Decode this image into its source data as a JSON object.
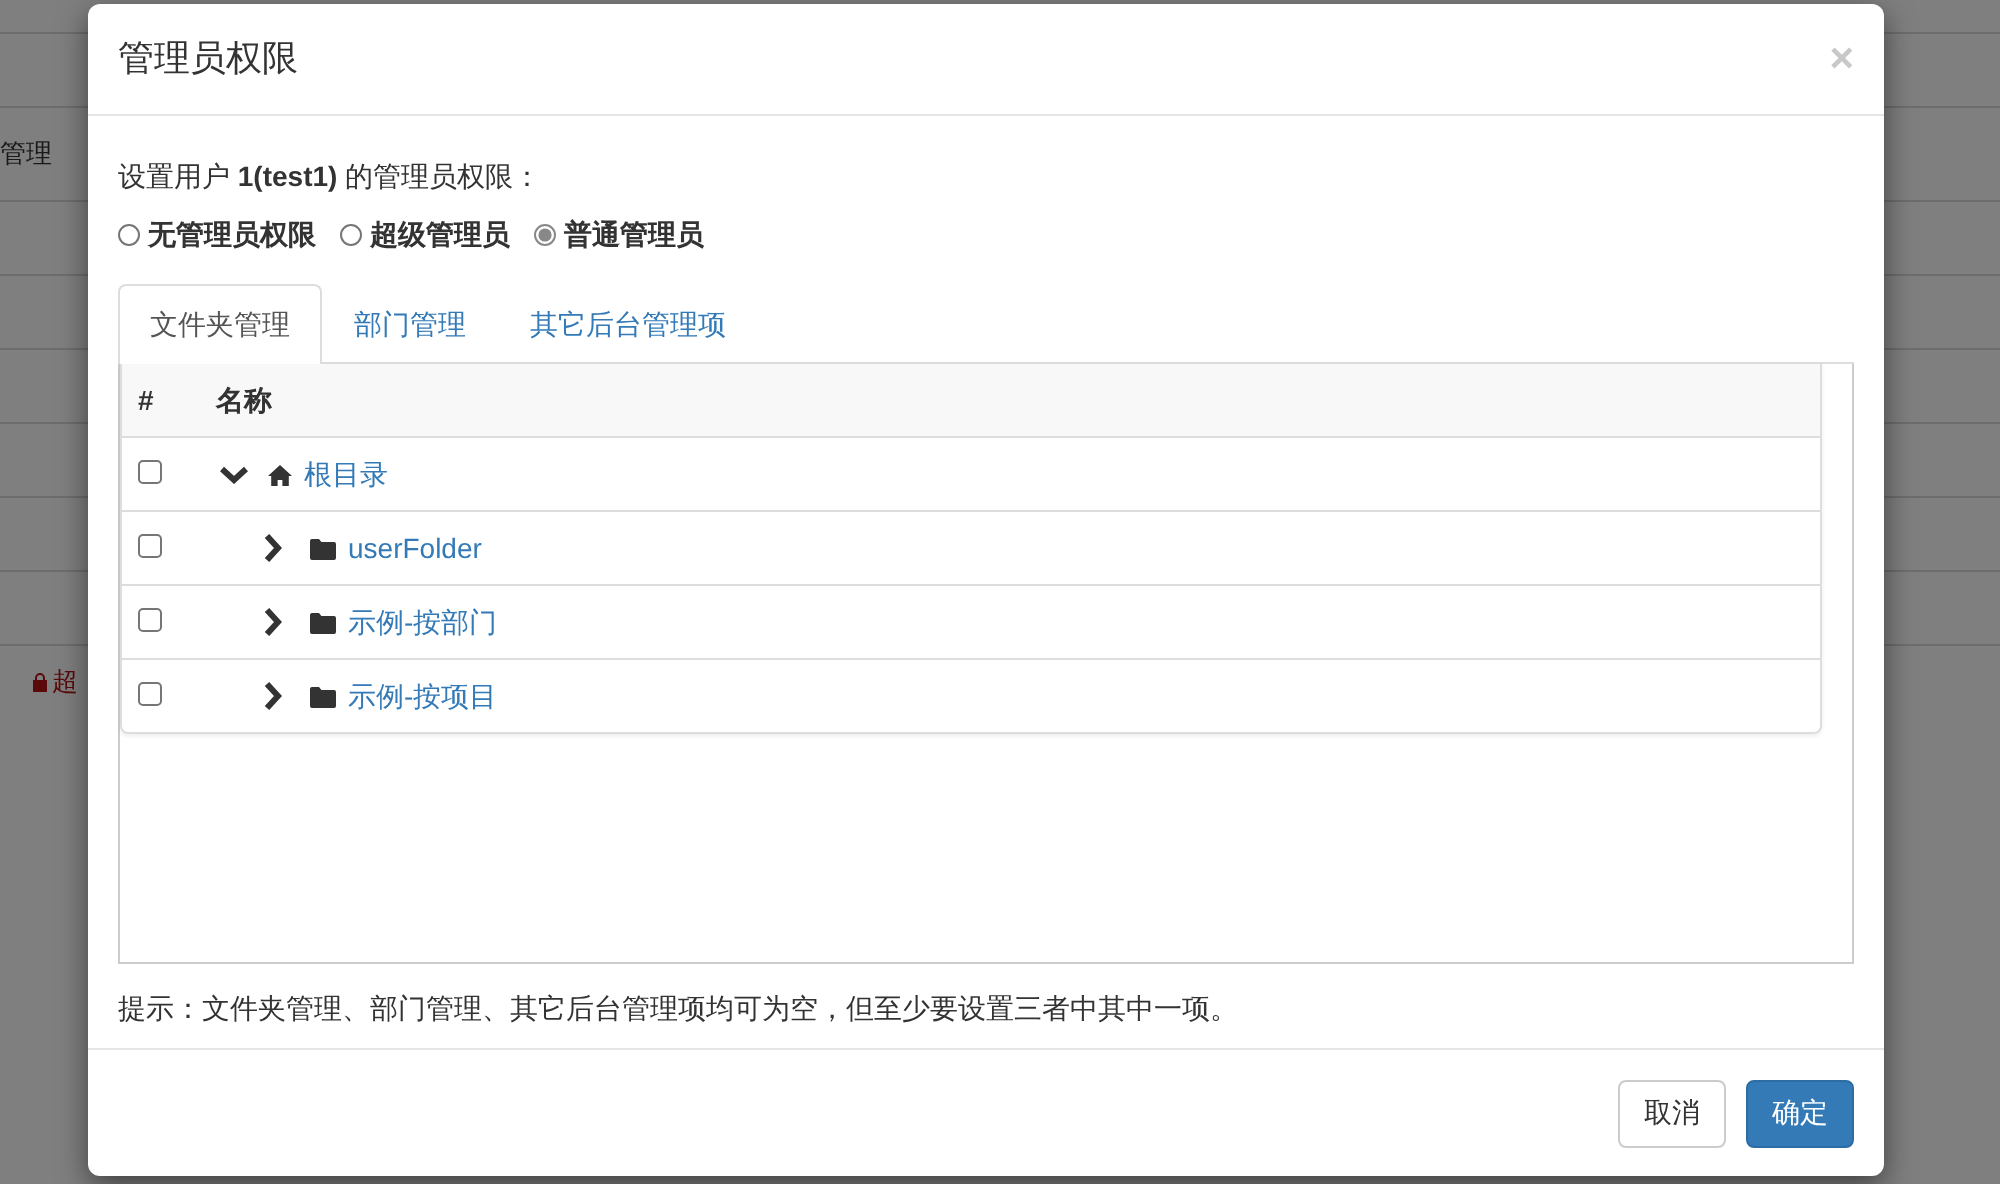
{
  "background": {
    "rows": [
      {
        "text": ""
      },
      {
        "text": "管理"
      },
      {
        "text": ""
      },
      {
        "text": ""
      },
      {
        "text": ""
      },
      {
        "text": ""
      },
      {
        "text": ""
      },
      {
        "text": ""
      },
      {
        "text": "超",
        "locked": true
      }
    ]
  },
  "dialog": {
    "title": "管理员权限",
    "close": "×",
    "intro": "设置用户 **1(test1)** 的管理员权限：",
    "roles": [
      {
        "label": "无管理员权限",
        "selected": false
      },
      {
        "label": "超级管理员",
        "selected": false
      },
      {
        "label": "普通管理员",
        "selected": true
      }
    ],
    "tabs": [
      {
        "label": "文件夹管理",
        "selected": true
      },
      {
        "label": "部门管理",
        "selected": false
      },
      {
        "label": "其它后台管理项",
        "selected": false
      }
    ],
    "table": {
      "columns": [
        "#",
        "名称"
      ],
      "tree": [
        {
          "label": "根目录",
          "kind": "home",
          "checked": false,
          "expanded": true,
          "children": [
            {
              "label": "userFolder",
              "kind": "folder",
              "checked": false,
              "expanded": false
            },
            {
              "label": "示例-按部门",
              "kind": "folder",
              "checked": false,
              "expanded": false
            },
            {
              "label": "示例-按项目",
              "kind": "folder",
              "checked": false,
              "expanded": false
            }
          ]
        }
      ]
    },
    "hint": "提示：文件夹管理、部门管理、其它后台管理项均可为空，但至少要设置三者中其中一项。",
    "buttons": [
      {
        "label": "取消",
        "kind": "secondary"
      },
      {
        "label": "确定",
        "kind": "primary"
      }
    ]
  }
}
